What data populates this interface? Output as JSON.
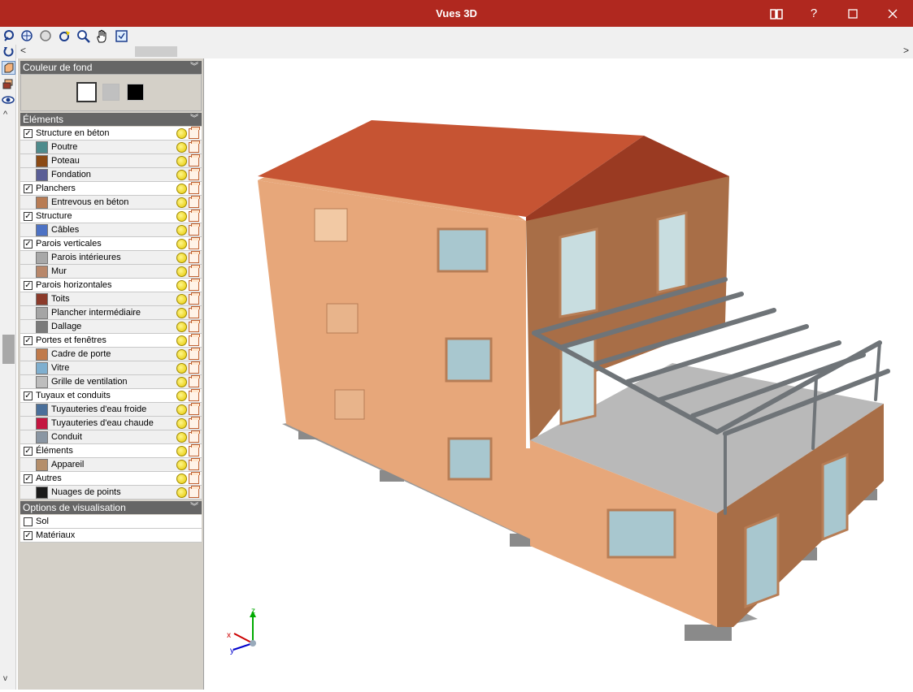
{
  "window": {
    "title": "Vues 3D"
  },
  "title_buttons": {
    "book": "📖",
    "help": "?",
    "maximize": "☐",
    "close": "✕"
  },
  "panels": {
    "background": {
      "title": "Couleur de fond",
      "colors": [
        "#ffffff",
        "#c0c0c0",
        "#000000"
      ],
      "selected": 0
    },
    "elements": {
      "title": "Éléments",
      "groups": [
        {
          "label": "Structure en béton",
          "checked": true,
          "items": [
            {
              "label": "Poutre",
              "color": "#4e8b8c"
            },
            {
              "label": "Poteau",
              "color": "#8b4a14"
            },
            {
              "label": "Fondation",
              "color": "#5a5e96"
            }
          ]
        },
        {
          "label": "Planchers",
          "checked": true,
          "items": [
            {
              "label": "Entrevous en béton",
              "color": "#b87c54"
            }
          ]
        },
        {
          "label": "Structure",
          "checked": true,
          "items": [
            {
              "label": "Câbles",
              "color": "#4d72c4"
            }
          ]
        },
        {
          "label": "Parois verticales",
          "checked": true,
          "items": [
            {
              "label": "Parois intérieures",
              "color": "#a8a8a8"
            },
            {
              "label": "Mur",
              "color": "#b8876a"
            }
          ]
        },
        {
          "label": "Parois horizontales",
          "checked": true,
          "items": [
            {
              "label": "Toits",
              "color": "#8b3a2a"
            },
            {
              "label": "Plancher intermédiaire",
              "color": "#a5a5a5"
            },
            {
              "label": "Dallage",
              "color": "#7a7a7a"
            }
          ]
        },
        {
          "label": "Portes et fenêtres",
          "checked": true,
          "items": [
            {
              "label": "Cadre de porte",
              "color": "#c07a4a"
            },
            {
              "label": "Vitre",
              "color": "#7fafcf"
            },
            {
              "label": "Grille de ventilation",
              "color": "#bdbdbd"
            }
          ]
        },
        {
          "label": "Tuyaux et conduits",
          "checked": true,
          "items": [
            {
              "label": "Tuyauteries d'eau froide",
              "color": "#4a6f9a"
            },
            {
              "label": "Tuyauteries d'eau chaude",
              "color": "#c41640"
            },
            {
              "label": "Conduit",
              "color": "#8a96a3"
            }
          ]
        },
        {
          "label": "Éléments",
          "checked": true,
          "items": [
            {
              "label": "Appareil",
              "color": "#b48e6a"
            }
          ]
        },
        {
          "label": "Autres",
          "checked": true,
          "items": [
            {
              "label": "Nuages de points",
              "color": "#1a1a1a"
            }
          ]
        }
      ]
    },
    "options": {
      "title": "Options de visualisation",
      "items": [
        {
          "label": "Sol",
          "checked": false
        },
        {
          "label": "Matériaux",
          "checked": true
        }
      ]
    }
  },
  "axes": {
    "x": "x",
    "y": "y",
    "z": "z"
  }
}
